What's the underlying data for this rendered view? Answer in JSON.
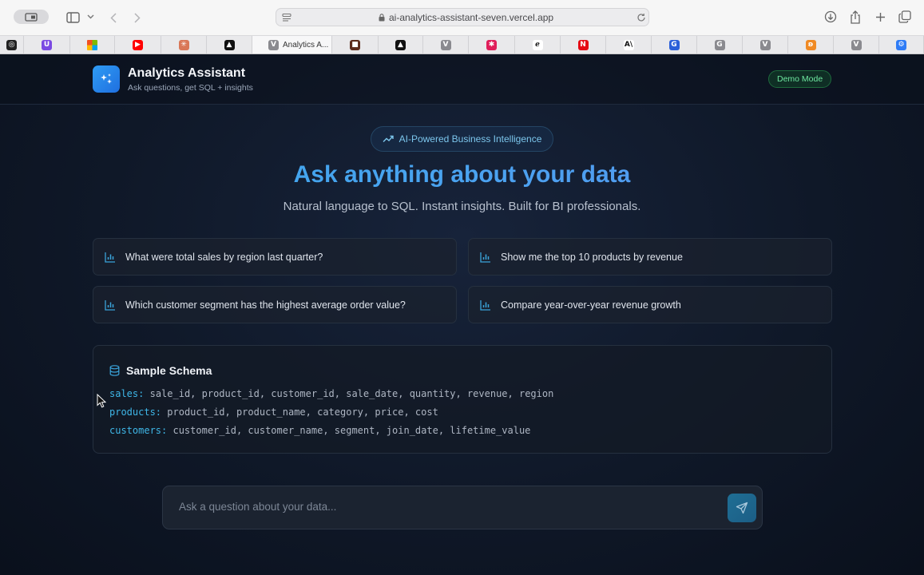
{
  "browser": {
    "address_url": "ai-analytics-assistant-seven.vercel.app",
    "active_tab_title": "Analytics A..."
  },
  "tabs": [
    {
      "favicon": "openai-icon",
      "color": "#222222",
      "glyph": "◎"
    },
    {
      "favicon": "proton-icon",
      "color": "#7b4ae2",
      "glyph": "U"
    },
    {
      "favicon": "microsoft-icon",
      "color": "#f25022",
      "glyph": ""
    },
    {
      "favicon": "youtube-icon",
      "color": "#ff0000",
      "glyph": "▶"
    },
    {
      "favicon": "claude-icon",
      "color": "#d97757",
      "glyph": "✳"
    },
    {
      "favicon": "triangle-icon",
      "color": "#111111",
      "glyph": "▲"
    },
    {
      "favicon": "v-icon",
      "color": "#8a8a8f",
      "glyph": "V"
    },
    {
      "favicon": "app-icon",
      "color": "#5b2a1a",
      "glyph": "■"
    },
    {
      "favicon": "triangle-icon",
      "color": "#111111",
      "glyph": "▲"
    },
    {
      "favicon": "v-icon",
      "color": "#8a8a8f",
      "glyph": "V"
    },
    {
      "favicon": "slack-icon",
      "color": "#e01e5a",
      "glyph": "✱"
    },
    {
      "favicon": "e-icon",
      "color": "#ffffff",
      "glyph": "ℯ"
    },
    {
      "favicon": "netflix-icon",
      "color": "#e50914",
      "glyph": "N"
    },
    {
      "favicon": "anthropic-icon",
      "color": "#ffffff",
      "glyph": "A\\"
    },
    {
      "favicon": "g-icon",
      "color": "#2b5fd9",
      "glyph": "G"
    },
    {
      "favicon": "g-icon",
      "color": "#8a8a8f",
      "glyph": "G"
    },
    {
      "favicon": "v-icon",
      "color": "#8a8a8f",
      "glyph": "V"
    },
    {
      "favicon": "orange-icon",
      "color": "#f08a24",
      "glyph": "ʚ"
    },
    {
      "favicon": "v-icon",
      "color": "#8a8a8f",
      "glyph": "V"
    },
    {
      "favicon": "settings-icon",
      "color": "#2f7cf6",
      "glyph": "⚙"
    }
  ],
  "header": {
    "title": "Analytics Assistant",
    "subtitle": "Ask questions, get SQL + insights",
    "badge": "Demo Mode"
  },
  "hero": {
    "pill": "AI-Powered Business Intelligence",
    "title": "Ask anything about your data",
    "subtitle": "Natural language to SQL. Instant insights. Built for BI professionals."
  },
  "questions": [
    "What were total sales by region last quarter?",
    "Show me the top 10 products by revenue",
    "Which customer segment has the highest average order value?",
    "Compare year-over-year revenue growth"
  ],
  "schema": {
    "title": "Sample Schema",
    "tables": [
      {
        "name": "sales:",
        "columns": "sale_id, product_id, customer_id, sale_date, quantity, revenue, region"
      },
      {
        "name": "products:",
        "columns": "product_id, product_name, category, price, cost"
      },
      {
        "name": "customers:",
        "columns": "customer_id, customer_name, segment, join_date, lifetime_value"
      }
    ]
  },
  "chat": {
    "placeholder": "Ask a question about your data..."
  },
  "colors": {
    "accent": "#39a8ea",
    "badge_green": "#6ee7a0",
    "schema_table": "#3fb7e8",
    "background": "#0c1220"
  }
}
